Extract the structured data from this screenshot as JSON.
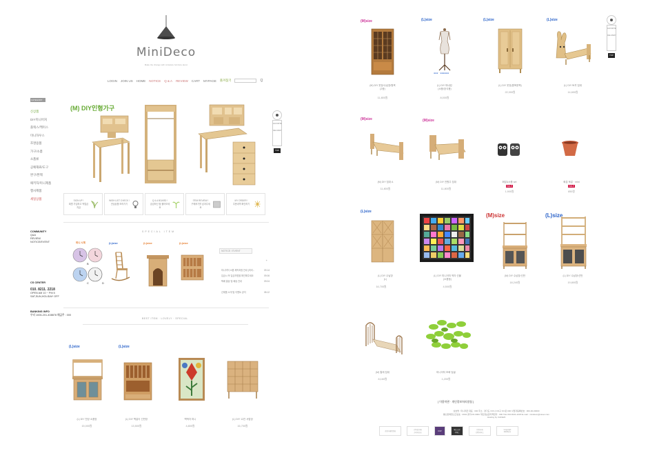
{
  "brand": {
    "logo_text": "MiniDeco",
    "tagline": "Make the change with miniature furniture decor"
  },
  "topnav": {
    "items": [
      {
        "label": "LOGIN",
        "style": ""
      },
      {
        "label": "JOIN US",
        "style": ""
      },
      {
        "label": "HOME",
        "style": ""
      },
      {
        "label": "NOTICE",
        "style": "hl"
      },
      {
        "label": "Q & A",
        "style": "hl"
      },
      {
        "label": "REVIEW",
        "style": "hl"
      },
      {
        "label": "CART",
        "style": ""
      },
      {
        "label": "MYPAGE",
        "style": ""
      },
      {
        "label": "즐겨찾기",
        "style": "green"
      }
    ],
    "search_placeholder": ""
  },
  "sidebar": {
    "category_header": "CATEGORY",
    "categories": [
      "신상품",
      "DIY미니어처",
      "플렉스/케이스",
      "미니하우스",
      "조명용품",
      "가구/소품",
      "소품류",
      "공예재료/도구",
      "완구/완제",
      "패키지/미니제품",
      "행사제품",
      "세일상품"
    ],
    "community": {
      "title": "COMMUNITY",
      "items": [
        "Q&A",
        "REVIEW",
        "NOTICE/EVENT"
      ]
    },
    "cs": {
      "title": "CS CENTER",
      "phone": "010. 8211. 2218",
      "hours": "OPEN AM 10 ~ PM 5",
      "closed": "SAT,SUN,HOLIDAY OFF"
    },
    "banking": {
      "title": "BANKING INFO",
      "line": "우리 1006-201-408878 예금주 : 000"
    }
  },
  "banner": {
    "title": "(M) DIY인형가구"
  },
  "feature_boxes": [
    {
      "line1": "SIGN UP !",
      "line2": "회원 가입하고 적립금 지급"
    },
    {
      "line1": "WISH LIST CHECK !",
      "line2": "관심상품 보러가기"
    },
    {
      "line1": "Q & A  BOARD !",
      "line2": "궁금하신 점 물어보세요"
    },
    {
      "line1": "ITEM REVIEW !",
      "line2": "구매후기를 남겨주세요"
    },
    {
      "line1": "MY ORDER !",
      "line2": "주문내역 확인하기"
    }
  ],
  "special": {
    "title": "SPECIAL ITEM",
    "labels": [
      "미니 시계",
      "(L)size",
      "(L)size",
      "(L)size"
    ]
  },
  "notice": {
    "tab": "NOTICE / EVENT",
    "more": "+",
    "items": [
      {
        "t": "미니어처 소품 제작과정 안내 (미리...",
        "d": "09.14"
      },
      {
        "t": "입금시 꼭 입금자명을 확인해주세요",
        "d": "09.06"
      },
      {
        "t": "택배 발송 및 배송 안내",
        "d": "09.04"
      },
      {
        "t": "신제품 소개 및 이벤트 공지",
        "d": "08.12"
      }
    ]
  },
  "best": {
    "title": "BEST ITEM · LOVELY · SPECIAL",
    "items": [
      {
        "size": "(L)size",
        "caption": "(L) DIY 찬장 소품장",
        "price": "15,000원"
      },
      {
        "size": "(L)size",
        "caption": "(L) DIY 벽걸이 선반장",
        "price": "13,500원"
      },
      {
        "size": "",
        "caption": "벽액자 미니",
        "price": "4,800원"
      },
      {
        "size": "",
        "caption": "(L) DIY 12칸 서랍장",
        "price": "16,700원"
      }
    ]
  },
  "right": {
    "row1": [
      {
        "size": "(M)size",
        "size_style": "m",
        "caption": "(M) DIY 옷장/수납장/원목\n(2종)",
        "price": "11,800원"
      },
      {
        "size": "(L)size",
        "size_style": "l",
        "caption": "(L) DIY 마네킹\n(소품/장식용)",
        "price": "8,000원"
      },
      {
        "size": "(L)size",
        "size_style": "l",
        "caption": "(L) DIY 옷장(원목문짝)",
        "price": "22,000원"
      },
      {
        "size": "(L)size",
        "size_style": "l",
        "caption": "(L) DIY 토끼 침대",
        "price": "14,600원"
      }
    ],
    "row2": [
      {
        "size": "(M)size",
        "size_style": "m",
        "caption": "(M) DIY 침대 A",
        "price": "11,800원"
      },
      {
        "size": "(M)size",
        "size_style": "m",
        "caption": "(M) DIY 전원주 침대",
        "price": "11,800원"
      },
      {
        "size": "",
        "size_style": "",
        "caption": "화분&소품 set",
        "price": "1,900원",
        "badge": "SALE"
      },
      {
        "size": "",
        "size_style": "",
        "caption": "화분 토분 · mini",
        "price": "850원",
        "badge": "SALE"
      }
    ],
    "row3": [
      {
        "size": "(L)size",
        "size_style": "l",
        "caption": "(L) DIY 수납장\n(L)",
        "price": "16,700원"
      },
      {
        "size": "",
        "size_style": "",
        "caption": "(L) DIY 미니어처 액자 선물\n(소품등)",
        "price": "4,500원"
      },
      {
        "size": "(M)size",
        "size_style": "m orange",
        "caption": "(M) DIY 수납장/선반",
        "price": "18,240원"
      },
      {
        "size": "(L)size",
        "size_style": "l",
        "caption": "(L) DIY 수납장/선반",
        "price": "19,800원"
      }
    ],
    "row4": [
      {
        "caption": "(M) 철제 침대",
        "price": "8,160원"
      },
      {
        "caption": "미니어처 조화 덩굴",
        "price": "1,200원"
      }
    ]
  },
  "footer": {
    "title": "[ 이용약관 · 개인정보처리방침 ]",
    "lines": [
      "상호명 : 미니데코 대표 : 000 주소 : 경기도 OO시 OO구 OO로 000 사업자등록번호 : 000-00-00000",
      "통신판매업신고번호 : 2016-경기OO-0000 개인정보관리책임자 : 000 TEL 010-8211-2218 E-mail : minideco@naver.com",
      "Hosting by  CAFE24"
    ],
    "badges": [
      "공정거래위원회",
      "전자상거래\n소비자보호",
      "KCP",
      "에스크로\n서비스",
      "안전거래\n인증서비스",
      "Copyright\nMiniDeco"
    ]
  },
  "side_widget": {
    "label1": "FAVORITE",
    "label2": "DELIVERY",
    "top": "TOP"
  }
}
